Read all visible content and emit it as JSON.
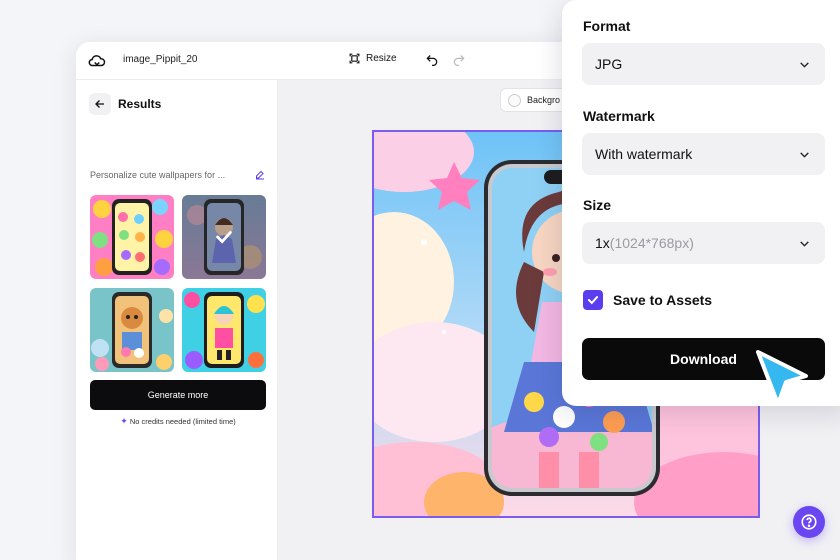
{
  "colors": {
    "accent": "#5b3df0",
    "button_dark": "#0a0a0b",
    "help": "#6a45f2",
    "cursor": "#35b8ef"
  },
  "topbar": {
    "file_name": "image_Pippit_20",
    "resize_label": "Resize",
    "icons": [
      "cloud-icon",
      "resize-icon",
      "undo-icon",
      "redo-icon"
    ]
  },
  "left_panel": {
    "title": "Results",
    "prompt": "Personalize cute wallpapers for ...",
    "generate_label": "Generate more",
    "credits_note": "No credits needed (limited time)",
    "thumbnail_count": 4,
    "selected_thumbnail": 2
  },
  "canvas": {
    "background_label": "Backgro"
  },
  "export": {
    "format_label": "Format",
    "format_value": "JPG",
    "watermark_label": "Watermark",
    "watermark_value": "With watermark",
    "size_label": "Size",
    "size_value": "1x",
    "size_detail": "(1024*768px)",
    "save_label": "Save to Assets",
    "save_checked": true,
    "download_label": "Download"
  }
}
